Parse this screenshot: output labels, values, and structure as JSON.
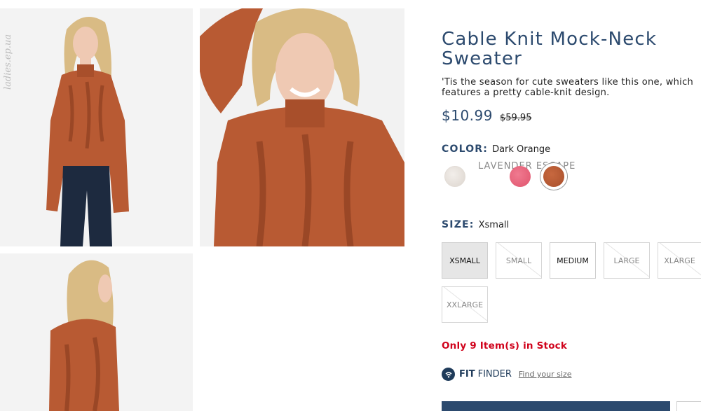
{
  "watermark": "ladies.ep.ua",
  "product": {
    "title": "Cable Knit Mock-Neck Sweater",
    "description": "'Tis the season for cute sweaters like this one, which features a pretty cable-knit design.",
    "price_sale": "$10.99",
    "price_original": "$59.95"
  },
  "color": {
    "label": "COLOR:",
    "selected": "Dark Orange",
    "hover_label": "LAVENDER ESCAPE",
    "swatches": [
      {
        "name": "cream",
        "hex": "#e8e2dc"
      },
      {
        "name": "pink",
        "hex": "#e8607a"
      },
      {
        "name": "dark-orange",
        "hex": "#b85a33"
      }
    ]
  },
  "size": {
    "label": "SIZE:",
    "selected": "Xsmall",
    "options": [
      "XSMALL",
      "SMALL",
      "MEDIUM",
      "LARGE",
      "XLARGE",
      "XXLARGE"
    ]
  },
  "stock": "Only 9 Item(s) in Stock",
  "fit_finder": {
    "strong": "FIT",
    "light": "FINDER",
    "link": "Find your size"
  },
  "colors": {
    "brand_navy": "#2c4a6e",
    "stock_red": "#d0021b",
    "sweater": "#b85a33"
  }
}
